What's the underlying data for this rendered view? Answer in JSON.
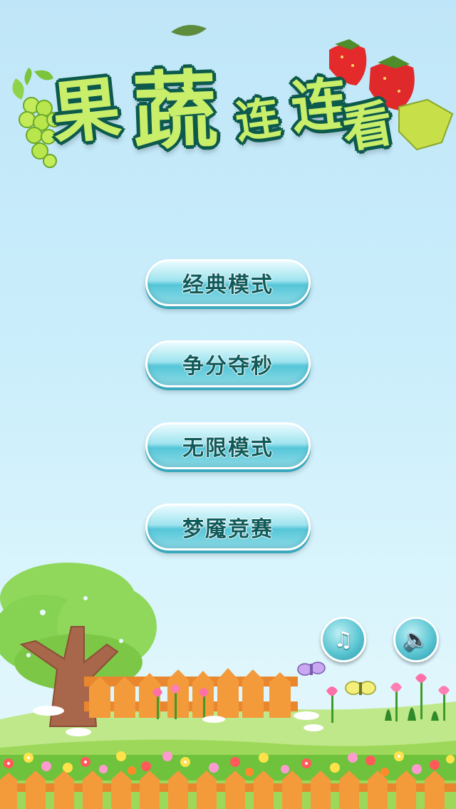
{
  "title": {
    "chars": [
      "果",
      "蔬",
      "连",
      "连",
      "看"
    ]
  },
  "menu": {
    "classic_label": "经典模式",
    "timed_label": "争分夺秒",
    "endless_label": "无限模式",
    "contest_label": "梦魇竞赛"
  },
  "controls": {
    "music_glyph": "♫",
    "sound_glyph": "🔈"
  },
  "colors": {
    "sky_top": "#bfe6f8",
    "title_fill": "#c9ee6a",
    "title_outline": "#0d5a4c",
    "button_teal": "#56c6d8",
    "fence_orange": "#f39a3b",
    "grass_green": "#8ccf3a"
  }
}
